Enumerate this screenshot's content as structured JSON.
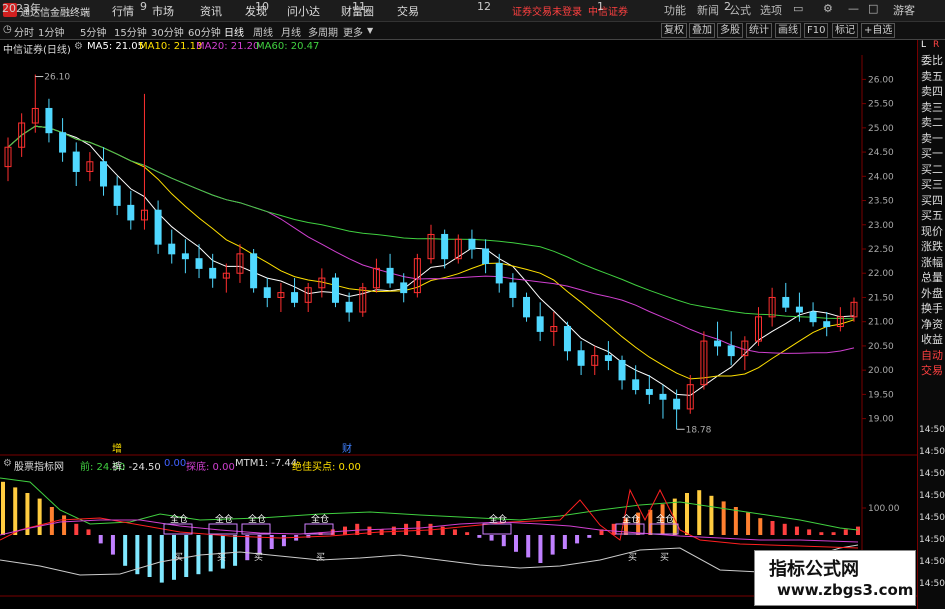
{
  "titlebar": {
    "app": "通达信金融终端",
    "menus": [
      "行情",
      "市场",
      "资讯",
      "发现",
      "问小达",
      "财富圈",
      "交易"
    ],
    "notice": "证券交易未登录",
    "broker": "中信证券",
    "right_buttons": [
      "功能",
      "新闻",
      "公式",
      "选项",
      "游客"
    ]
  },
  "toolbar": {
    "periods": [
      "分时",
      "1分钟",
      "5分钟",
      "15分钟",
      "30分钟",
      "60分钟",
      "日线",
      "周线",
      "月线",
      "多周期",
      "更多"
    ],
    "active_period": "日线",
    "right_tools": [
      "复权",
      "叠加",
      "多股",
      "统计",
      "画线",
      "F10",
      "标记",
      "+自选"
    ]
  },
  "stock": {
    "name": "中信证券(日线)",
    "ma": [
      {
        "label": "MA5: 21.05",
        "color": "#ffffff"
      },
      {
        "label": "MA10: 21.13",
        "color": "#ffe000"
      },
      {
        "label": "MA20: 21.20",
        "color": "#d040d0"
      },
      {
        "label": "MA60: 20.47",
        "color": "#40d040"
      }
    ],
    "high_label": "26.10",
    "low_label": "18.78",
    "price_axis": [
      "26.00",
      "25.50",
      "25.00",
      "24.50",
      "24.00",
      "23.50",
      "23.00",
      "22.50",
      "22.00",
      "21.50",
      "21.00",
      "20.50",
      "20.00",
      "19.50",
      "19.00"
    ],
    "markers": [
      {
        "text": "增"
      },
      {
        "text": "财"
      }
    ]
  },
  "indicator": {
    "name": "股票指标网",
    "values": [
      {
        "label": "前: 24.50",
        "color": "#40d040"
      },
      {
        "label": "裤: -24.50",
        "color": "#dddddd"
      },
      {
        "label": "0.00",
        "color": "#4060ff"
      },
      {
        "label": "探底: 0.00",
        "color": "#d040d0"
      },
      {
        "label": "MTM1: -7.44",
        "color": "#dddddd"
      },
      {
        "label": "绝佳买点: 0.00",
        "color": "#ffe000"
      }
    ],
    "axis_label": "100.00",
    "signals": [
      "全仓",
      "全仓",
      "全仓",
      "全仓",
      "全仓",
      "全仓",
      "全仓"
    ],
    "buy_marks": [
      "买",
      "买",
      "买",
      "买",
      "买",
      "买"
    ]
  },
  "right_panel": [
    "委比",
    "卖五",
    "卖四",
    "卖三",
    "卖二",
    "卖一",
    "买一",
    "买二",
    "买三",
    "买四",
    "买五",
    "现价",
    "涨跌",
    "涨幅",
    "总量",
    "外盘",
    "换手",
    "净资",
    "收益",
    "自动",
    "交易"
  ],
  "right_panel_top": [
    "L",
    "R"
  ],
  "right_times": [
    "14:50",
    "14:50",
    "14:50",
    "14:50",
    "14:50",
    "14:50",
    "14:50",
    "14:50"
  ],
  "time_axis": [
    "2023年",
    "9",
    "10",
    "11",
    "12",
    "1",
    "2"
  ],
  "watermark": {
    "line1": "指标公式网",
    "line2": "www.zbgs3.com"
  },
  "chart_data": {
    "type": "candlestick",
    "title": "中信证券(日线)",
    "y_range": [
      18.6,
      26.4
    ],
    "ohlc": [
      [
        24.2,
        24.8,
        23.9,
        24.6
      ],
      [
        24.6,
        25.3,
        24.4,
        25.1
      ],
      [
        25.1,
        26.1,
        24.9,
        25.4
      ],
      [
        25.4,
        25.6,
        24.7,
        24.9
      ],
      [
        24.9,
        25.2,
        24.3,
        24.5
      ],
      [
        24.5,
        24.7,
        23.8,
        24.1
      ],
      [
        24.1,
        24.5,
        23.9,
        24.3
      ],
      [
        24.3,
        24.6,
        23.6,
        23.8
      ],
      [
        23.8,
        24.0,
        23.2,
        23.4
      ],
      [
        23.4,
        23.7,
        22.9,
        23.1
      ],
      [
        23.1,
        25.7,
        22.9,
        23.3
      ],
      [
        23.3,
        23.5,
        22.4,
        22.6
      ],
      [
        22.6,
        22.9,
        22.2,
        22.4
      ],
      [
        22.4,
        22.7,
        22.0,
        22.3
      ],
      [
        22.3,
        22.6,
        21.9,
        22.1
      ],
      [
        22.1,
        22.4,
        21.7,
        21.9
      ],
      [
        21.9,
        22.2,
        21.6,
        22.0
      ],
      [
        22.0,
        22.6,
        21.8,
        22.4
      ],
      [
        22.4,
        22.5,
        21.6,
        21.7
      ],
      [
        21.7,
        21.9,
        21.3,
        21.5
      ],
      [
        21.5,
        21.8,
        21.2,
        21.6
      ],
      [
        21.6,
        21.9,
        21.3,
        21.4
      ],
      [
        21.4,
        21.8,
        21.2,
        21.7
      ],
      [
        21.7,
        22.1,
        21.5,
        21.9
      ],
      [
        21.9,
        22.0,
        21.3,
        21.4
      ],
      [
        21.4,
        21.6,
        21.0,
        21.2
      ],
      [
        21.2,
        21.8,
        21.1,
        21.7
      ],
      [
        21.7,
        22.3,
        21.6,
        22.1
      ],
      [
        22.1,
        22.4,
        21.7,
        21.8
      ],
      [
        21.8,
        22.0,
        21.4,
        21.6
      ],
      [
        21.6,
        22.4,
        21.5,
        22.3
      ],
      [
        22.3,
        23.0,
        22.2,
        22.8
      ],
      [
        22.8,
        22.9,
        22.1,
        22.3
      ],
      [
        22.3,
        22.8,
        22.2,
        22.7
      ],
      [
        22.7,
        22.9,
        22.3,
        22.5
      ],
      [
        22.5,
        22.7,
        22.0,
        22.2
      ],
      [
        22.2,
        22.4,
        21.6,
        21.8
      ],
      [
        21.8,
        22.0,
        21.3,
        21.5
      ],
      [
        21.5,
        21.6,
        21.0,
        21.1
      ],
      [
        21.1,
        21.4,
        20.6,
        20.8
      ],
      [
        20.8,
        21.2,
        20.5,
        20.9
      ],
      [
        20.9,
        21.0,
        20.2,
        20.4
      ],
      [
        20.4,
        20.6,
        19.9,
        20.1
      ],
      [
        20.1,
        20.5,
        19.9,
        20.3
      ],
      [
        20.3,
        20.6,
        20.0,
        20.2
      ],
      [
        20.2,
        20.3,
        19.6,
        19.8
      ],
      [
        19.8,
        20.1,
        19.5,
        19.6
      ],
      [
        19.6,
        19.9,
        19.3,
        19.5
      ],
      [
        19.5,
        19.7,
        19.0,
        19.4
      ],
      [
        19.4,
        19.6,
        18.78,
        19.2
      ],
      [
        19.2,
        19.9,
        19.1,
        19.7
      ],
      [
        19.7,
        20.8,
        19.6,
        20.6
      ],
      [
        20.6,
        21.0,
        20.3,
        20.5
      ],
      [
        20.5,
        20.8,
        20.1,
        20.3
      ],
      [
        20.3,
        20.7,
        20.0,
        20.6
      ],
      [
        20.6,
        21.3,
        20.5,
        21.1
      ],
      [
        21.1,
        21.7,
        20.9,
        21.5
      ],
      [
        21.5,
        21.8,
        21.2,
        21.3
      ],
      [
        21.3,
        21.6,
        21.0,
        21.2
      ],
      [
        21.2,
        21.4,
        20.9,
        21.0
      ],
      [
        21.0,
        21.2,
        20.7,
        20.9
      ],
      [
        20.9,
        21.3,
        20.8,
        21.1
      ],
      [
        21.1,
        21.5,
        21.0,
        21.4
      ]
    ],
    "series": [
      {
        "name": "MA5",
        "color": "#ffffff"
      },
      {
        "name": "MA10",
        "color": "#ffe000"
      },
      {
        "name": "MA20",
        "color": "#d040d0"
      },
      {
        "name": "MA60",
        "color": "#40d040"
      }
    ]
  }
}
